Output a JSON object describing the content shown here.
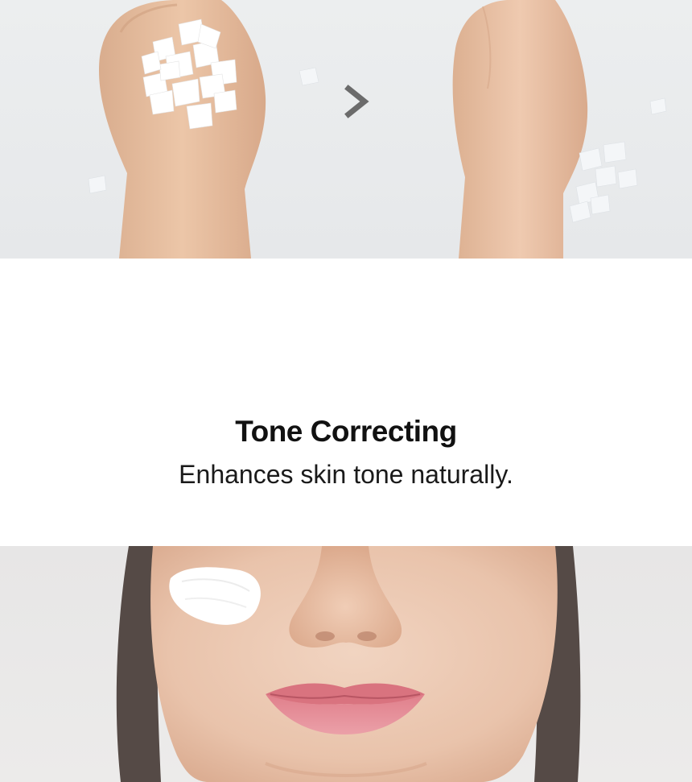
{
  "feature": {
    "title": "Tone Correcting",
    "description": "Enhances skin tone naturally."
  },
  "icons": {
    "arrow": "chevron-right-icon"
  },
  "colors": {
    "background": "#ffffff",
    "photo_background": "#e9ebec",
    "skin": "#e8c3a6",
    "product_swatch": "#ffffff",
    "lips": "#e6919b",
    "arrow": "#6b6b6b",
    "text": "#111111"
  }
}
